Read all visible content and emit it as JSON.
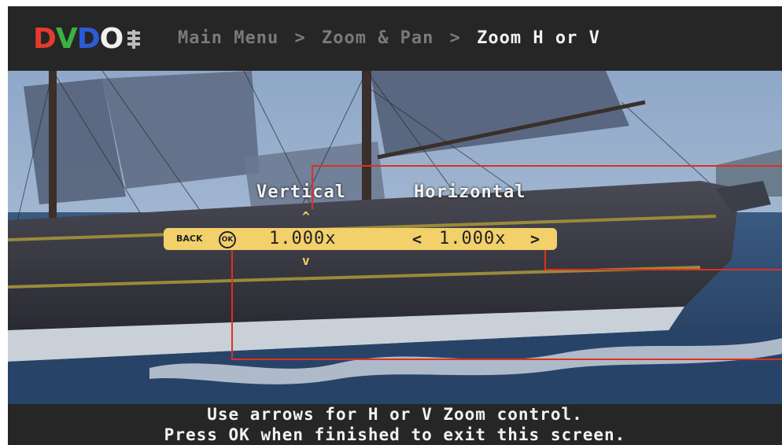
{
  "header": {
    "logo": {
      "letters": [
        "D",
        "V",
        "D",
        "O"
      ],
      "colors": [
        "#e53a2c",
        "#3cb043",
        "#2d5bd8",
        "#f0f0f0"
      ]
    },
    "breadcrumb": {
      "items": [
        "Main Menu",
        "Zoom & Pan"
      ],
      "separator": ">",
      "current": "Zoom H or V"
    }
  },
  "overlay": {
    "vertical_label": "Vertical",
    "horizontal_label": "Horizontal",
    "back_label": "BACK",
    "ok_label": "OK",
    "vertical_value": "1.000x",
    "horizontal_value": "1.000x",
    "left_arrow": "<",
    "right_arrow": ">",
    "up_arrow": "^",
    "down_arrow": "v",
    "bar_color": "#f2d06a",
    "annotation_color": "#e0301e"
  },
  "footer": {
    "line1": "Use arrows for H or V Zoom control.",
    "line2": "Press OK when finished to exit this screen."
  }
}
